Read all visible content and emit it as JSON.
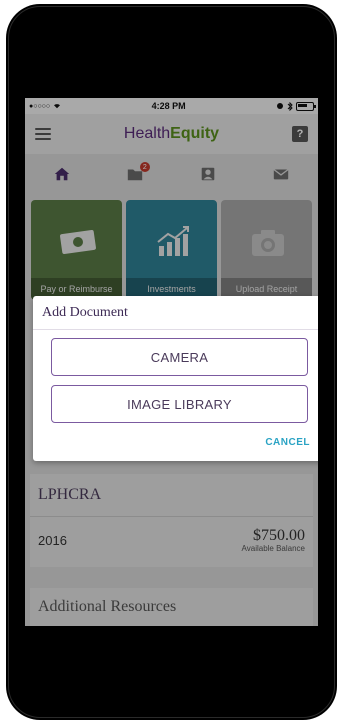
{
  "status_bar": {
    "signal": "●○○○○",
    "time": "4:28 PM"
  },
  "header": {
    "logo_health": "Health",
    "logo_equity": "Equity",
    "help": "?"
  },
  "tabs": [
    {
      "icon": "home-icon",
      "active": true
    },
    {
      "icon": "folder-icon",
      "badge": "2"
    },
    {
      "icon": "contact-icon"
    },
    {
      "icon": "mail-icon"
    }
  ],
  "tiles": [
    {
      "label": "Pay or Reimburse",
      "icon": "money-icon",
      "color": "#5a7a45"
    },
    {
      "label": "Investments",
      "icon": "chart-icon",
      "color": "#2e8196"
    },
    {
      "label": "Upload Receipt",
      "icon": "camera-icon",
      "color": "#a8a8a8"
    }
  ],
  "account": {
    "name": "LPHCRA",
    "year": "2016",
    "amount": "$750.00",
    "amount_label": "Available Balance"
  },
  "resources": {
    "title": "Additional Resources"
  },
  "dialog": {
    "title": "Add Document",
    "camera_label": "CAMERA",
    "library_label": "IMAGE LIBRARY",
    "cancel_label": "CANCEL"
  },
  "colors": {
    "brand_purple": "#5a2c79",
    "brand_green": "#5a8f1d",
    "accent_cyan": "#2aa3c4"
  }
}
